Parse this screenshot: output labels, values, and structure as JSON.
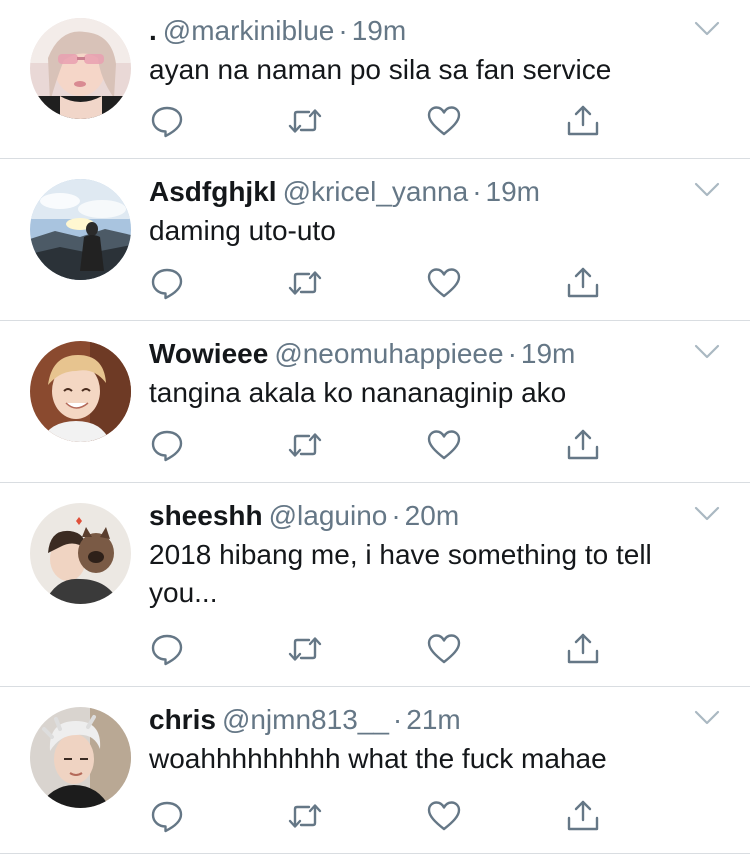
{
  "colors": {
    "text": "#14171a",
    "secondary": "#657786",
    "divider": "#d9dde1",
    "icon": "#657786"
  },
  "tweets": [
    {
      "display_name": ".",
      "handle": "@markiniblue",
      "separator": "·",
      "time": "19m",
      "text": "ayan na naman po sila sa fan service"
    },
    {
      "display_name": "Asdfghjkl",
      "handle": "@kricel_yanna",
      "separator": "·",
      "time": "19m",
      "text": "daming uto-uto"
    },
    {
      "display_name": "Wowieee",
      "handle": "@neomuhappieee",
      "separator": "·",
      "time": "19m",
      "text": "tangina akala ko nananaginip ako"
    },
    {
      "display_name": "sheeshh",
      "handle": "@laguino",
      "separator": "·",
      "time": "20m",
      "text": "2018 hibang me, i have something to tell you..."
    },
    {
      "display_name": "chris",
      "handle": "@njmn813__",
      "separator": "·",
      "time": "21m",
      "text": "woahhhhhhhhh what the fuck mahae"
    }
  ],
  "icons": {
    "reply": "reply-icon",
    "retweet": "retweet-icon",
    "like": "heart-icon",
    "share": "share-icon",
    "more": "chevron-down-icon"
  }
}
